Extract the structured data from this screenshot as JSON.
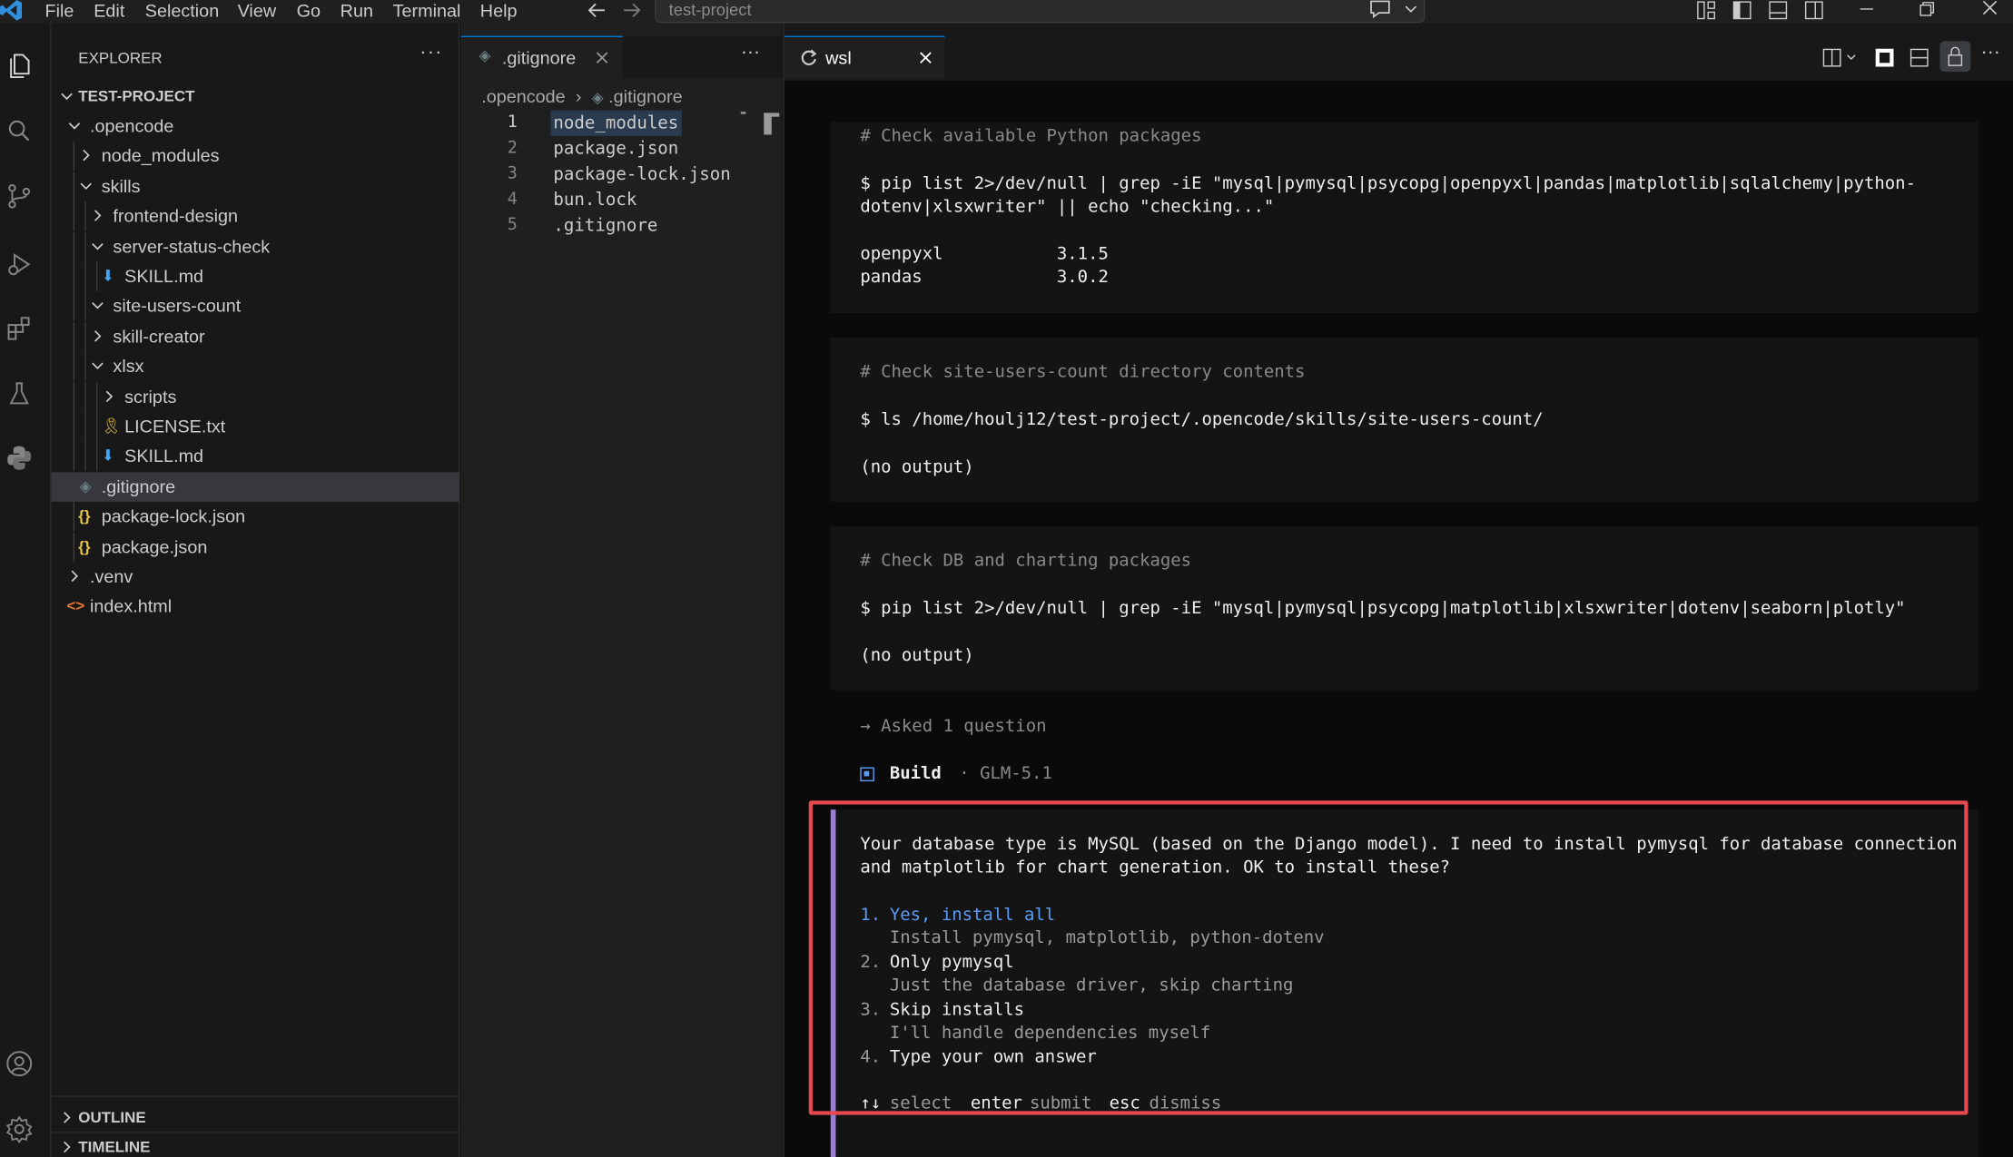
{
  "menu": [
    "File",
    "Edit",
    "Selection",
    "View",
    "Go",
    "Run",
    "Terminal",
    "Help"
  ],
  "command_center": "test-project",
  "explorer": {
    "title": "EXPLORER",
    "project": "TEST-PROJECT",
    "items": [
      {
        "label": ".opencode",
        "type": "folder-open",
        "depth": 1
      },
      {
        "label": "node_modules",
        "type": "folder",
        "depth": 2
      },
      {
        "label": "skills",
        "type": "folder-open",
        "depth": 2
      },
      {
        "label": "frontend-design",
        "type": "folder",
        "depth": 3
      },
      {
        "label": "server-status-check",
        "type": "folder-open",
        "depth": 3
      },
      {
        "label": "SKILL.md",
        "type": "md",
        "depth": 4
      },
      {
        "label": "site-users-count",
        "type": "folder-open",
        "depth": 3
      },
      {
        "label": "skill-creator",
        "type": "folder",
        "depth": 3
      },
      {
        "label": "xlsx",
        "type": "folder-open",
        "depth": 3
      },
      {
        "label": "scripts",
        "type": "folder",
        "depth": 4
      },
      {
        "label": "LICENSE.txt",
        "type": "license",
        "depth": 4
      },
      {
        "label": "SKILL.md",
        "type": "md",
        "depth": 4
      },
      {
        "label": ".gitignore",
        "type": "git",
        "depth": 2,
        "selected": true
      },
      {
        "label": "package-lock.json",
        "type": "json",
        "depth": 2
      },
      {
        "label": "package.json",
        "type": "json",
        "depth": 2
      },
      {
        "label": ".venv",
        "type": "folder",
        "depth": 1
      },
      {
        "label": "index.html",
        "type": "html",
        "depth": 1
      }
    ],
    "outline": "OUTLINE",
    "timeline": "TIMELINE"
  },
  "editor": {
    "tab": ".gitignore",
    "breadcrumb": [
      ".opencode",
      ".gitignore"
    ],
    "lines": [
      "node_modules",
      "package.json",
      "package-lock.json",
      "bun.lock",
      ".gitignore"
    ],
    "line_numbers": [
      "1",
      "2",
      "3",
      "4",
      "5"
    ]
  },
  "terminal": {
    "tab": "wsl",
    "block1": {
      "comment": "# Check available Python packages",
      "cmd1": "$ pip list 2>/dev/null | grep -iE \"mysql|pymysql|psycopg|openpyxl|pandas|matplotlib|sqlalchemy|python-",
      "cmd2": "dotenv|xlsxwriter\" || echo \"checking...\"",
      "out1": "openpyxl           3.1.5",
      "out2": "pandas             3.0.2"
    },
    "block2": {
      "comment": "# Check site-users-count directory contents",
      "cmd": "$ ls /home/houlj12/test-project/.opencode/skills/site-users-count/",
      "out": "(no output)"
    },
    "block3": {
      "comment": "# Check DB and charting packages",
      "cmd": "$ pip list 2>/dev/null | grep -iE \"mysql|pymysql|psycopg|matplotlib|xlsxwriter|dotenv|seaborn|plotly\"",
      "out": "(no output)"
    },
    "asked": "→ Asked 1 question",
    "build_label": "Build",
    "build_model": " · GLM-5.1",
    "question": {
      "line1": "Your database type is MySQL (based on the Django model). I need to install pymysql for database connection",
      "line2": "and matplotlib for chart generation. OK to install these?",
      "options": [
        {
          "num": "1.",
          "label": "Yes, install all",
          "desc": "Install pymysql, matplotlib, python-dotenv"
        },
        {
          "num": "2.",
          "label": "Only pymysql",
          "desc": "Just the database driver, skip charting"
        },
        {
          "num": "3.",
          "label": "Skip installs",
          "desc": "I'll handle dependencies myself"
        },
        {
          "num": "4.",
          "label": "Type your own answer",
          "desc": ""
        }
      ],
      "hint_arrows": "↑↓",
      "hint_select": "select",
      "hint_enter": "enter",
      "hint_submit": "submit",
      "hint_esc": "esc",
      "hint_dismiss": "dismiss"
    }
  },
  "colors": {
    "accent": "#0078d4",
    "highlight_box": "#e5484d",
    "option_selected": "#5c9cf5",
    "question_bar": "#9d7cd8"
  }
}
